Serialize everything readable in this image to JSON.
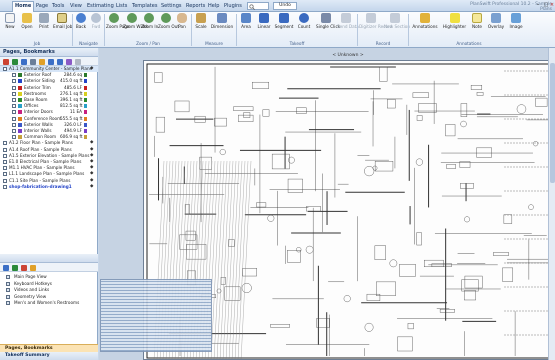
{
  "menu": {
    "tabs": [
      "Home",
      "Page",
      "Tools",
      "View",
      "Estimating",
      "Lists",
      "Templates",
      "Settings",
      "Reports",
      "Help",
      "Plugins"
    ],
    "search_placeholder": "",
    "undo_label": "Undo",
    "app_title": "PlanSwift Professional 10.2 - Sample Plans"
  },
  "ribbon": {
    "buttons": [
      {
        "label": "New",
        "icon": "new-icon"
      },
      {
        "label": "Open",
        "icon": "open-icon"
      },
      {
        "label": "Print",
        "icon": "print-icon"
      },
      {
        "label": "Email Job",
        "icon": "email-icon"
      },
      {
        "label": "Back",
        "icon": "back-icon"
      },
      {
        "label": "Fwd",
        "icon": "forward-icon"
      },
      {
        "label": "Zoom Page",
        "icon": "zoom-page-icon"
      },
      {
        "label": "Zoom Width",
        "icon": "zoom-width-icon"
      },
      {
        "label": "Zoom In",
        "icon": "zoom-in-icon"
      },
      {
        "label": "Zoom Out",
        "icon": "zoom-out-icon"
      },
      {
        "label": "Pan",
        "icon": "pan-icon"
      },
      {
        "label": "Scale",
        "icon": "scale-icon"
      },
      {
        "label": "Dimension",
        "icon": "dimension-icon"
      },
      {
        "label": "Area",
        "icon": "area-icon"
      },
      {
        "label": "Linear",
        "icon": "linear-icon"
      },
      {
        "label": "Segment",
        "icon": "segment-icon"
      },
      {
        "label": "Count",
        "icon": "count-icon"
      },
      {
        "label": "Single Click",
        "icon": "single-click-icon"
      },
      {
        "label": "Send Data",
        "icon": "send-data-icon"
      },
      {
        "label": "Digitizer Record",
        "icon": "digitizer-icon"
      },
      {
        "label": "New Section",
        "icon": "new-section-icon"
      },
      {
        "label": "Annotations",
        "icon": "annotations-icon"
      },
      {
        "label": "Highlighter",
        "icon": "highlighter-icon"
      },
      {
        "label": "Note",
        "icon": "note-icon"
      },
      {
        "label": "Overlay",
        "icon": "overlay-icon"
      },
      {
        "label": "Image",
        "icon": "image-icon"
      }
    ],
    "groups": [
      "Job",
      "Navigate",
      "Zoom / Pan",
      "Measure",
      "Takeoff",
      "Record",
      "Annotations"
    ]
  },
  "left_panel": {
    "title": "Pages, Bookmarks",
    "tree": [
      {
        "label": "A1.1 Community Center - Sample Plans",
        "value": "",
        "color": "",
        "level": 0
      },
      {
        "label": "Exterior Roof",
        "value": "284.6 sq",
        "color": "#2c7a2c",
        "level": 1
      },
      {
        "label": "Exterior Siding",
        "value": "415.0 sq ft",
        "color": "#2444c8",
        "level": 1
      },
      {
        "label": "Exterior Trim",
        "value": "485.6 LF",
        "color": "#c62020",
        "level": 1
      },
      {
        "label": "Restrooms",
        "value": "276.1 sq ft",
        "color": "#d8d020",
        "level": 1
      },
      {
        "label": "Base Room",
        "value": "396.1 sq ft",
        "color": "#2c8a2c",
        "level": 1
      },
      {
        "label": "Offices",
        "value": "812.5 sq ft",
        "color": "#28a0c8",
        "level": 1
      },
      {
        "label": "Interior Doors",
        "value": "11 EA",
        "color": "#c82080",
        "level": 1
      },
      {
        "label": "Conference Room",
        "value": "555.5 sq ft",
        "color": "#e08020",
        "level": 1
      },
      {
        "label": "Exterior Walls",
        "value": "326.0 LF",
        "color": "#3b58c6",
        "level": 1
      },
      {
        "label": "Interior Walls",
        "value": "494.9 LF",
        "color": "#7a3bc6",
        "level": 1
      },
      {
        "label": "Common Room",
        "value": "606.9 sq ft",
        "color": "#c6a03b",
        "level": 1
      },
      {
        "label": "A1.2 Floor Plan - Sample Plans",
        "value": "",
        "color": "",
        "level": 0
      },
      {
        "label": "A1.4 Roof Plan - Sample Plans",
        "value": "",
        "color": "",
        "level": 0
      },
      {
        "label": "A1.5 Exterior Elevation - Sample Plans",
        "value": "",
        "color": "",
        "level": 0
      },
      {
        "label": "E1.0 Electrical Plan - Sample Plans",
        "value": "",
        "color": "",
        "level": 0
      },
      {
        "label": "M1.1 HVAC Plan - Sample Plans",
        "value": "",
        "color": "",
        "level": 0
      },
      {
        "label": "L1.1 Landscape Plan - Sample Plans",
        "value": "",
        "color": "",
        "level": 0
      },
      {
        "label": "C1.1 Site Plan - Sample Plans",
        "value": "",
        "color": "",
        "level": 0
      },
      {
        "label": "shop-fabrication-drawing1",
        "value": "",
        "color": "",
        "level": 0
      }
    ],
    "bookmarks": [
      "Main Page View",
      "Keyboard Hotkeys",
      "Videos and Links",
      "Geometry View",
      "Men's and Women's Restrooms"
    ],
    "bottom_tab_active": "Pages, Bookmarks",
    "bottom_tab_other": "Takeoff Summary"
  },
  "drawing": {
    "page_label": "< Unknown >"
  }
}
